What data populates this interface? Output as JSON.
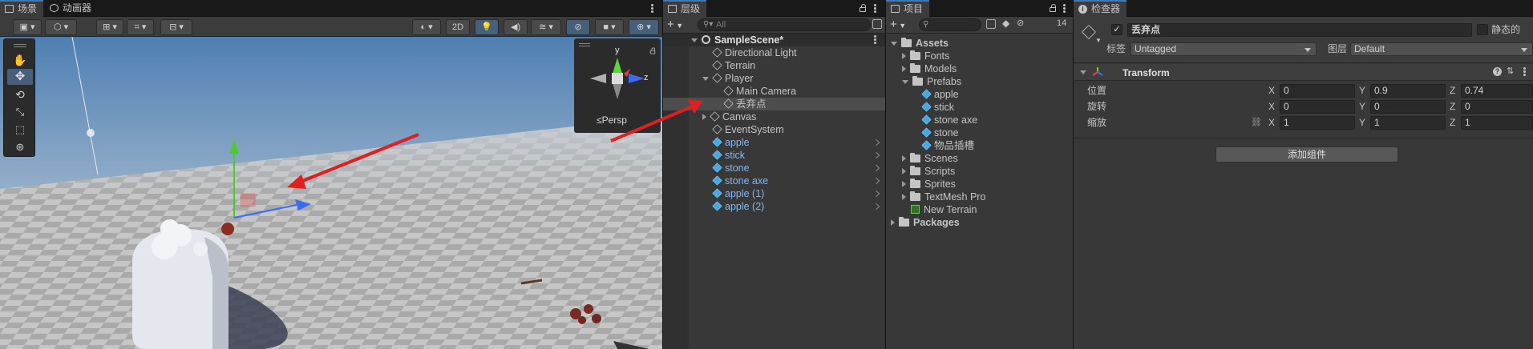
{
  "scene_panel": {
    "tabs": [
      {
        "label": "场景"
      },
      {
        "label": "动画器"
      }
    ],
    "toolbar": {
      "btn_2d": "2D"
    },
    "gizmo": {
      "axis_y": "y",
      "axis_z": "z",
      "persp_label": "≤Persp"
    }
  },
  "hierarchy": {
    "tab_label": "层级",
    "search_placeholder": "All",
    "add_label": "+",
    "scene_name": "SampleScene*",
    "items": [
      {
        "label": "Directional Light"
      },
      {
        "label": "Terrain"
      },
      {
        "label": "Player"
      },
      {
        "label": "Main Camera"
      },
      {
        "label": "丢弃点"
      },
      {
        "label": "Canvas"
      },
      {
        "label": "EventSystem"
      },
      {
        "label": "apple"
      },
      {
        "label": "stick"
      },
      {
        "label": "stone"
      },
      {
        "label": "stone axe"
      },
      {
        "label": "apple (1)"
      },
      {
        "label": "apple (2)"
      }
    ]
  },
  "project": {
    "tab_label": "项目",
    "add_label": "+",
    "hidden_count": "14",
    "tree": [
      {
        "label": "Assets"
      },
      {
        "label": "Fonts"
      },
      {
        "label": "Models"
      },
      {
        "label": "Prefabs"
      },
      {
        "label": "apple"
      },
      {
        "label": "stick"
      },
      {
        "label": "stone axe"
      },
      {
        "label": "stone"
      },
      {
        "label": "物品插槽"
      },
      {
        "label": "Scenes"
      },
      {
        "label": "Scripts"
      },
      {
        "label": "Sprites"
      },
      {
        "label": "TextMesh Pro"
      },
      {
        "label": "New Terrain"
      },
      {
        "label": "Packages"
      }
    ]
  },
  "inspector": {
    "tab_label": "检查器",
    "object_name": "丢弃点",
    "static_label": "静态的",
    "tag_label": "标签",
    "tag_value": "Untagged",
    "layer_label": "图层",
    "layer_value": "Default",
    "component_name": "Transform",
    "position_label": "位置",
    "rotation_label": "旋转",
    "scale_label": "缩放",
    "axis_x": "X",
    "axis_y": "Y",
    "axis_z": "Z",
    "position": {
      "x": "0",
      "y": "0.9",
      "z": "0.74"
    },
    "rotation": {
      "x": "0",
      "y": "0",
      "z": "0"
    },
    "scale": {
      "x": "1",
      "y": "1",
      "z": "1"
    },
    "add_component_label": "添加组件"
  },
  "colors": {
    "accent": "#3a79bb",
    "prefab_blue": "#7cb8ff",
    "arrow_red": "#e02020"
  }
}
